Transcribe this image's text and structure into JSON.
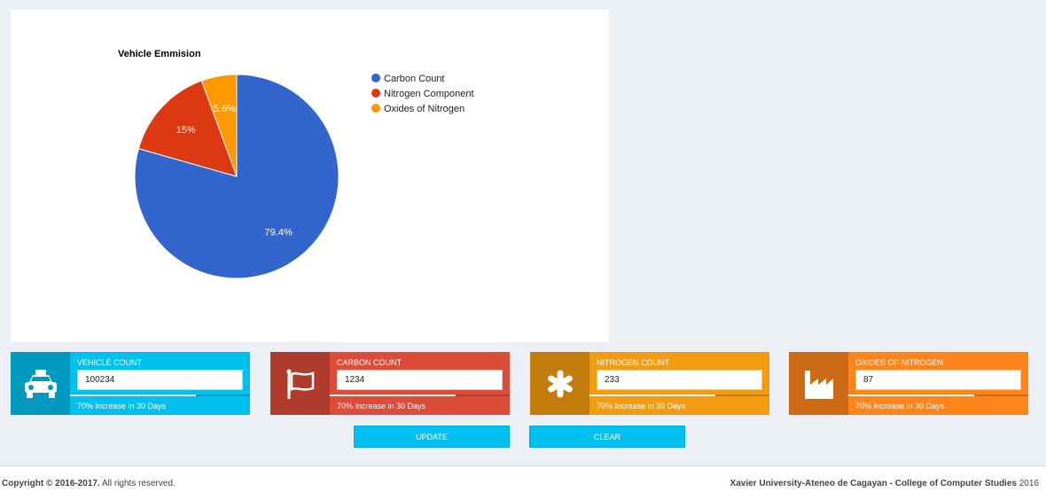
{
  "chart_data": {
    "type": "pie",
    "title": "Vehicle Emmision",
    "slices": [
      {
        "label": "Carbon Count",
        "value": 79.4,
        "percent_label": "79.4%",
        "color": "#3366cc"
      },
      {
        "label": "Nitrogen Component",
        "value": 15,
        "percent_label": "15%",
        "color": "#dc3912"
      },
      {
        "label": "Oxides of Nitrogen",
        "value": 5.6,
        "percent_label": "5.6%",
        "color": "#ff9900"
      }
    ],
    "legend_position": "right"
  },
  "info_boxes": [
    {
      "label": "VEHICLE COUNT",
      "value": "100234",
      "description": "70% Increase in 30 Days",
      "progress": 0.7,
      "icon": "taxi-icon",
      "color": "#00c0ef"
    },
    {
      "label": "CARBON COUNT",
      "value": "1234",
      "description": "70% Increase in 30 Days",
      "progress": 0.7,
      "icon": "flag-icon",
      "color": "#dd4b39"
    },
    {
      "label": "NITROGEN COUNT",
      "value": "233",
      "description": "70% Increase in 30 Days",
      "progress": 0.7,
      "icon": "asterisk-icon",
      "color": "#f39c12"
    },
    {
      "label": "OXIDES OF NITROGEN",
      "value": "87",
      "description": "70% Increase in 30 Days",
      "progress": 0.7,
      "icon": "industry-icon",
      "color": "#ff851b"
    }
  ],
  "buttons": {
    "update_label": "UPDATE",
    "clear_label": "CLEAR"
  },
  "footer": {
    "copyright_bold": "Copyright © 2016-2017.",
    "copyright_rest": " All rights reserved.",
    "org_bold": "Xavier University-Ateneo de Cagayan - College of Computer Studies",
    "org_year": " 2016"
  }
}
